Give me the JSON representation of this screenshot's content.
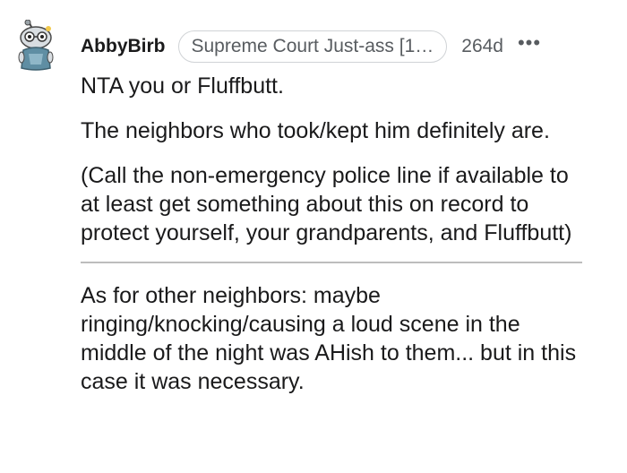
{
  "comment": {
    "author": "AbbyBirb",
    "flair": "Supreme Court Just-ass [1…",
    "age": "264d",
    "more_icon": "more-horizontal-icon",
    "avatar_icon": "snoo-avatar-icon",
    "paragraphs": [
      "NTA you or Fluffbutt.",
      "The neighbors who took/kept him definitely are.",
      "(Call the non-emergency police line if available to at least get something about this on record to protect yourself, your grandparents, and Fluffbutt)",
      "As for other neighbors: maybe ringing/knocking/causing a loud scene in the middle of the night was AHish to them... but in this case it was necessary."
    ]
  },
  "colors": {
    "text": "#1a1a1b",
    "meta": "#585c60",
    "divider": "#bdbdbd"
  }
}
